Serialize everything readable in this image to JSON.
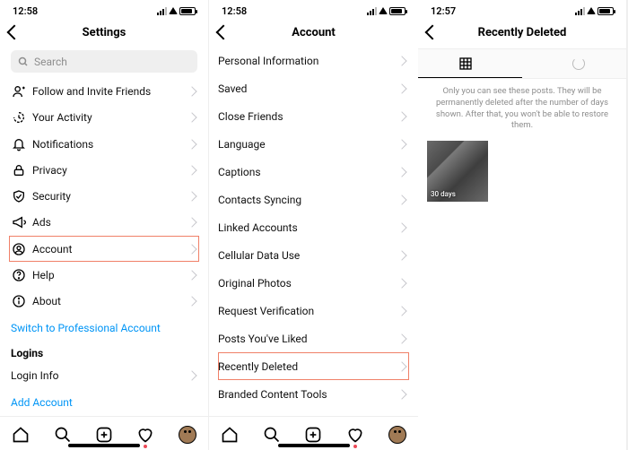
{
  "screens": {
    "settings": {
      "time": "12:58",
      "title": "Settings",
      "search_placeholder": "Search",
      "items": [
        {
          "label": "Follow and Invite Friends"
        },
        {
          "label": "Your Activity"
        },
        {
          "label": "Notifications"
        },
        {
          "label": "Privacy"
        },
        {
          "label": "Security"
        },
        {
          "label": "Ads"
        },
        {
          "label": "Account",
          "highlight": true
        },
        {
          "label": "Help"
        },
        {
          "label": "About"
        }
      ],
      "switch_link": "Switch to Professional Account",
      "logins_head": "Logins",
      "login_info": "Login Info",
      "add_account": "Add Account"
    },
    "account": {
      "time": "12:58",
      "title": "Account",
      "items": [
        {
          "label": "Personal Information"
        },
        {
          "label": "Saved"
        },
        {
          "label": "Close Friends"
        },
        {
          "label": "Language"
        },
        {
          "label": "Captions"
        },
        {
          "label": "Contacts Syncing"
        },
        {
          "label": "Linked Accounts"
        },
        {
          "label": "Cellular Data Use"
        },
        {
          "label": "Original Photos"
        },
        {
          "label": "Request Verification"
        },
        {
          "label": "Posts You've Liked"
        },
        {
          "label": "Recently Deleted",
          "highlight": true
        },
        {
          "label": "Branded Content Tools"
        }
      ]
    },
    "recently_deleted": {
      "time": "12:57",
      "title": "Recently Deleted",
      "note": "Only you can see these posts. They will be permanently deleted after the number of days shown. After that, you won't be able to restore them.",
      "thumb_badge": "30 days"
    }
  }
}
